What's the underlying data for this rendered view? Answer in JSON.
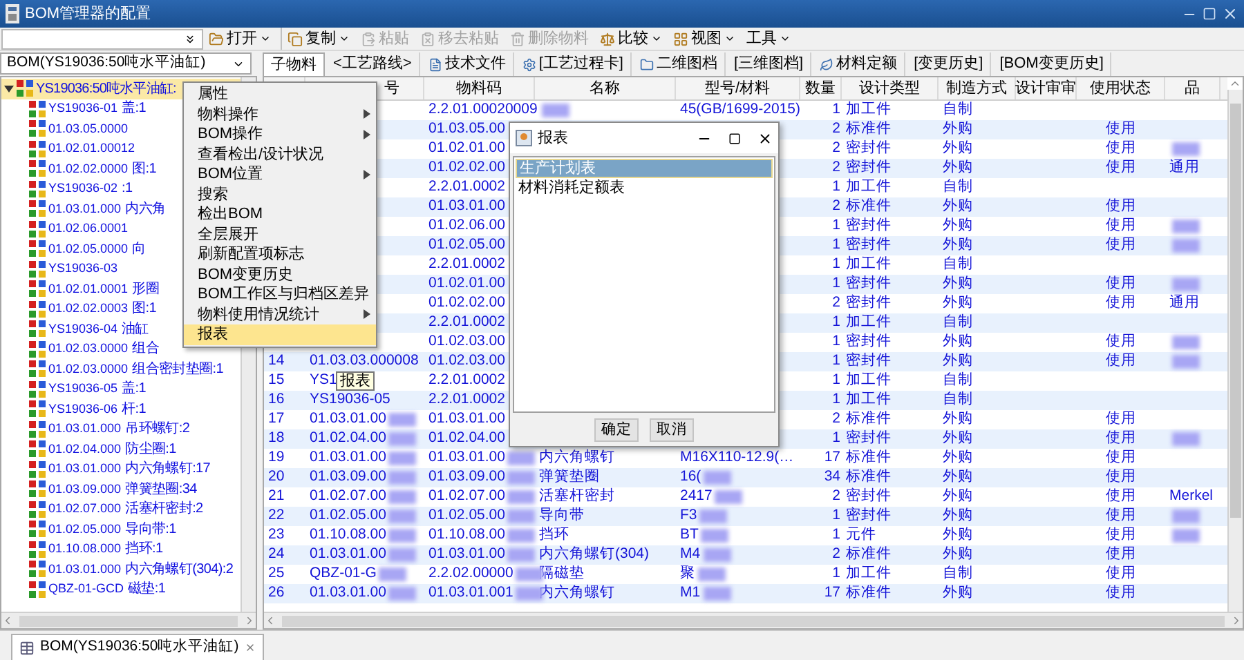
{
  "window": {
    "title": "BOM管理器的配置"
  },
  "toolbar": {
    "items": [
      {
        "label": "打开",
        "dropdown": true,
        "disabled": false
      },
      {
        "label": "复制",
        "dropdown": true,
        "disabled": false
      },
      {
        "label": "粘贴",
        "dropdown": false,
        "disabled": true
      },
      {
        "label": "移去粘贴",
        "dropdown": false,
        "disabled": true
      },
      {
        "label": "删除物料",
        "dropdown": false,
        "disabled": true
      },
      {
        "label": "比较",
        "dropdown": true,
        "disabled": false
      },
      {
        "label": "视图",
        "dropdown": true,
        "disabled": false
      },
      {
        "label": "工具",
        "dropdown": true,
        "disabled": false
      }
    ]
  },
  "bom_selector": {
    "value": "BOM(YS19036:50吨水平油缸)"
  },
  "tabs": [
    {
      "label": "子物料",
      "selected": true
    },
    {
      "label": "<工艺路线>",
      "selected": false
    },
    {
      "label": "技术文件",
      "selected": false
    },
    {
      "label": "[工艺过程卡]",
      "selected": false
    },
    {
      "label": "二维图档",
      "selected": false
    },
    {
      "label": "[三维图档]",
      "selected": false
    },
    {
      "label": "材料定额",
      "selected": false
    },
    {
      "label": "[变更历史]",
      "selected": false
    },
    {
      "label": "[BOM变更历史]",
      "selected": false
    }
  ],
  "tree": {
    "label": "YS19036:50吨水平油缸:",
    "selected": true,
    "expanded": true,
    "children": [
      {
        "code": "YS19036-01",
        "tail": "盖:1"
      },
      {
        "code": "01.03.05.0000"
      },
      {
        "code": "01.02.01.00012"
      },
      {
        "code": "01.02.02.0000",
        "tail": "图:1"
      },
      {
        "code": "YS19036-02",
        "tail": ":1"
      },
      {
        "code": "01.03.01.000",
        "tail": "内六角"
      },
      {
        "code": "01.02.06.0001"
      },
      {
        "code": "01.02.05.0000",
        "tail": "向"
      },
      {
        "code": "YS19036-03"
      },
      {
        "code": "01.02.01.0001",
        "tail": "形圈"
      },
      {
        "code": "01.02.02.0003",
        "tail": "图:1"
      },
      {
        "code": "YS19036-04",
        "tail": "油缸"
      },
      {
        "code": "01.02.03.0000",
        "tail": "组合"
      },
      {
        "code": "01.02.03.0000",
        "tail": "组合密封垫圈:1"
      },
      {
        "code": "YS19036-05",
        "tail": "盖:1"
      },
      {
        "code": "YS19036-06",
        "tail": "杆:1"
      },
      {
        "code": "01.03.01.000",
        "tail": "吊环螺钉:2"
      },
      {
        "code": "01.02.04.000",
        "tail": "防尘圈:1"
      },
      {
        "code": "01.03.01.000",
        "tail": "内六角螺钉:17"
      },
      {
        "code": "01.03.09.000",
        "tail": "弹簧垫圈:34"
      },
      {
        "code": "01.02.07.000",
        "tail": "活塞杆密封:2"
      },
      {
        "code": "01.02.05.000",
        "tail": "导向带:1"
      },
      {
        "code": "01.10.08.000",
        "tail": "挡环:1"
      },
      {
        "code": "01.03.01.000",
        "tail": "内六角螺钉(304):2"
      },
      {
        "code": "QBZ-01-GCD",
        "tail": "磁垫:1"
      }
    ]
  },
  "table": {
    "columns": [
      "号",
      "物料码",
      "名称",
      "型号/材料",
      "数量",
      "设计类型",
      "制造方式",
      "设计审审",
      "使用状态",
      "品"
    ],
    "rows": [
      {
        "material": {
          "text": "2.2.01.00020009"
        },
        "name": {
          "redacted": true
        },
        "model": {
          "text": "45(GB/1699-2015)"
        },
        "qty": {
          "text": "1"
        },
        "type": {
          "text": "加工件"
        },
        "make": {
          "text": "自制"
        }
      },
      {
        "material": {
          "text": "01.03.05.00"
        },
        "qty": {
          "text": "2"
        },
        "type": {
          "text": "标准件"
        },
        "make": {
          "text": "外购"
        },
        "status": {
          "text": "使用"
        }
      },
      {
        "material": {
          "text": "01.02.01.00"
        },
        "qty": {
          "text": "2"
        },
        "type": {
          "text": "密封件"
        },
        "make": {
          "text": "外购"
        },
        "status": {
          "text": "使用"
        },
        "column_10": {
          "redacted": true
        }
      },
      {
        "material": {
          "text": "01.02.02.00"
        },
        "qty": {
          "text": "2"
        },
        "type": {
          "text": "密封件"
        },
        "make": {
          "text": "外购"
        },
        "status": {
          "text": "使用"
        },
        "column_10": {
          "text": "通用"
        }
      },
      {
        "material": {
          "text": "2.2.01.0002"
        },
        "qty": {
          "text": "1"
        },
        "type": {
          "text": "加工件"
        },
        "make": {
          "text": "自制"
        }
      },
      {
        "material": {
          "text": "01.03.01.00"
        },
        "qty": {
          "text": "2"
        },
        "type": {
          "text": "标准件"
        },
        "make": {
          "text": "外购"
        },
        "status": {
          "text": "使用"
        }
      },
      {
        "material": {
          "text": "01.02.06.00"
        },
        "qty": {
          "text": "1"
        },
        "type": {
          "text": "密封件"
        },
        "make": {
          "text": "外购"
        },
        "status": {
          "text": "使用"
        },
        "column_10": {
          "redacted": true
        }
      },
      {
        "material": {
          "text": "01.02.05.00"
        },
        "qty": {
          "text": "1"
        },
        "type": {
          "text": "密封件"
        },
        "make": {
          "text": "外购"
        },
        "status": {
          "text": "使用"
        },
        "column_10": {
          "redacted": true
        }
      },
      {
        "material": {
          "text": "2.2.01.0002"
        },
        "qty": {
          "text": "1"
        },
        "type": {
          "text": "加工件"
        },
        "make": {
          "text": "自制"
        }
      },
      {
        "material": {
          "text": "01.02.01.00"
        },
        "qty": {
          "text": "1"
        },
        "type": {
          "text": "密封件"
        },
        "make": {
          "text": "外购"
        },
        "status": {
          "text": "使用"
        },
        "column_10": {
          "redacted": true
        }
      },
      {
        "material": {
          "text": "01.02.02.00"
        },
        "qty": {
          "text": "2"
        },
        "type": {
          "text": "密封件"
        },
        "make": {
          "text": "外购"
        },
        "status": {
          "text": "使用"
        },
        "column_10": {
          "text": "通用"
        }
      },
      {
        "material": {
          "text": "2.2.01.0002"
        },
        "qty": {
          "text": "1"
        },
        "type": {
          "text": "加工件"
        },
        "make": {
          "text": "自制"
        }
      },
      {
        "material": {
          "text": "01.02.03.00"
        },
        "qty": {
          "text": "1"
        },
        "type": {
          "text": "密封件"
        },
        "make": {
          "text": "外购"
        },
        "status": {
          "text": "使用"
        },
        "column_10": {
          "redacted": true
        }
      },
      {
        "no": "14",
        "code": {
          "text": "01.03.03.000008"
        },
        "material": {
          "text": "01.02.03.00"
        },
        "qty": {
          "text": "1"
        },
        "type": {
          "text": "密封件"
        },
        "make": {
          "text": "外购"
        },
        "status": {
          "text": "使用"
        },
        "column_10": {
          "redacted": true
        }
      },
      {
        "no": "15",
        "code": {
          "text": "YS1"
        },
        "material": {
          "text": "2.2.01.0002"
        },
        "qty": {
          "text": "1"
        },
        "type": {
          "text": "加工件"
        },
        "make": {
          "text": "自制"
        }
      },
      {
        "no": "16",
        "code": {
          "text": "YS19036-05"
        },
        "material": {
          "text": "2.2.01.0002"
        },
        "qty": {
          "text": "1"
        },
        "type": {
          "text": "加工件"
        },
        "make": {
          "text": "自制"
        }
      },
      {
        "no": "17",
        "code": {
          "text": "01.03.01.00",
          "redacted": true
        },
        "material": {
          "text": "01.03.01.00"
        },
        "qty": {
          "text": "2"
        },
        "type": {
          "text": "标准件"
        },
        "make": {
          "text": "外购"
        },
        "status": {
          "text": "使用"
        }
      },
      {
        "no": "18",
        "code": {
          "text": "01.02.04.00",
          "redacted": true
        },
        "material": {
          "text": "01.02.04.00"
        },
        "qty": {
          "text": "1"
        },
        "type": {
          "text": "密封件"
        },
        "make": {
          "text": "外购"
        },
        "status": {
          "text": "使用"
        },
        "column_10": {
          "redacted": true
        }
      },
      {
        "no": "19",
        "code": {
          "text": "01.03.01.00",
          "redacted": true
        },
        "material": {
          "text": "01.03.01.00",
          "redacted": true
        },
        "name": {
          "text": "内六角螺钉"
        },
        "model": {
          "text": "M16X110-12.9(…"
        },
        "qty": {
          "text": "17"
        },
        "type": {
          "text": "标准件"
        },
        "make": {
          "text": "外购"
        },
        "status": {
          "text": "使用"
        }
      },
      {
        "no": "20",
        "code": {
          "text": "01.03.09.00",
          "redacted": true
        },
        "material": {
          "text": "01.03.09.00",
          "redacted": true
        },
        "name": {
          "text": "弹簧垫圈"
        },
        "model": {
          "text": "16(",
          "redacted": true
        },
        "qty": {
          "text": "34"
        },
        "type": {
          "text": "标准件"
        },
        "make": {
          "text": "外购"
        },
        "status": {
          "text": "使用"
        }
      },
      {
        "no": "21",
        "code": {
          "text": "01.02.07.00",
          "redacted": true
        },
        "material": {
          "text": "01.02.07.00",
          "redacted": true
        },
        "name": {
          "text": "活塞杆密封"
        },
        "model": {
          "text": "2417",
          "redacted": true
        },
        "qty": {
          "text": "2"
        },
        "type": {
          "text": "密封件"
        },
        "make": {
          "text": "外购"
        },
        "status": {
          "text": "使用"
        },
        "column_10": {
          "text": "Merkel"
        }
      },
      {
        "no": "22",
        "code": {
          "text": "01.02.05.00",
          "redacted": true
        },
        "material": {
          "text": "01.02.05.00",
          "redacted": true
        },
        "name": {
          "text": "导向带"
        },
        "model": {
          "text": "F3",
          "redacted": true
        },
        "qty": {
          "text": "1"
        },
        "type": {
          "text": "密封件"
        },
        "make": {
          "text": "外购"
        },
        "status": {
          "text": "使用"
        },
        "column_10": {
          "redacted": true
        }
      },
      {
        "no": "23",
        "code": {
          "text": "01.10.08.00",
          "redacted": true
        },
        "material": {
          "text": "01.10.08.00",
          "redacted": true
        },
        "name": {
          "text": "挡环"
        },
        "model": {
          "text": "BT",
          "redacted": true
        },
        "qty": {
          "text": "1"
        },
        "type": {
          "text": "元件"
        },
        "make": {
          "text": "外购"
        },
        "status": {
          "text": "使用"
        },
        "column_10": {
          "redacted": true
        }
      },
      {
        "no": "24",
        "code": {
          "text": "01.03.01.00",
          "redacted": true
        },
        "material": {
          "text": "01.03.01.00",
          "redacted": true
        },
        "name": {
          "text": "内六角螺钉(304)"
        },
        "model": {
          "text": "M4",
          "redacted": true
        },
        "qty": {
          "text": "2"
        },
        "type": {
          "text": "标准件"
        },
        "make": {
          "text": "外购"
        },
        "status": {
          "text": "使用"
        }
      },
      {
        "no": "25",
        "code": {
          "text": "QBZ-01-G",
          "redacted": true
        },
        "material": {
          "text": "2.2.02.00000",
          "redacted": true
        },
        "name": {
          "text": "隔磁垫"
        },
        "model": {
          "text": "聚",
          "redacted": true
        },
        "qty": {
          "text": "1"
        },
        "type": {
          "text": "加工件"
        },
        "make": {
          "text": "自制"
        },
        "status": {
          "text": "使用"
        }
      },
      {
        "no": "26",
        "code": {
          "text": "01.03.01.00",
          "redacted": true
        },
        "material": {
          "text": "01.03.01.001",
          "redacted": true
        },
        "name": {
          "text": "内六角螺钉"
        },
        "model": {
          "text": "M1",
          "redacted": true
        },
        "qty": {
          "text": "17"
        },
        "type": {
          "text": "标准件"
        },
        "make": {
          "text": "外购"
        },
        "status": {
          "text": "使用"
        }
      }
    ]
  },
  "context_menu": {
    "items": [
      {
        "label": "属性",
        "submenu": false,
        "selected": false
      },
      {
        "label": "物料操作",
        "submenu": true,
        "selected": false
      },
      {
        "label": "BOM操作",
        "submenu": true,
        "selected": false
      },
      {
        "label": "查看检出/设计状况",
        "submenu": false,
        "selected": false
      },
      {
        "label": "BOM位置",
        "submenu": true,
        "selected": false
      },
      {
        "label": "搜索",
        "submenu": false,
        "selected": false
      },
      {
        "label": "检出BOM",
        "submenu": false,
        "selected": false
      },
      {
        "label": "全层展开",
        "submenu": false,
        "selected": false
      },
      {
        "label": "刷新配置项标志",
        "submenu": false,
        "selected": false
      },
      {
        "label": "BOM变更历史",
        "submenu": false,
        "selected": false
      },
      {
        "label": "BOM工作区与归档区差异",
        "submenu": false,
        "selected": false
      },
      {
        "label": "物料使用情况统计",
        "submenu": true,
        "selected": false
      },
      {
        "label": "报表",
        "submenu": false,
        "selected": true
      }
    ]
  },
  "tooltip": {
    "text": "报表"
  },
  "dialog": {
    "title": "报表",
    "items": [
      {
        "label": "生产计划表",
        "selected": true
      },
      {
        "label": "材料消耗定额表",
        "selected": false
      }
    ],
    "buttons": [
      "确定",
      "取消"
    ]
  },
  "editor_tab": {
    "label": "BOM(YS19036:50吨水平油缸)"
  }
}
